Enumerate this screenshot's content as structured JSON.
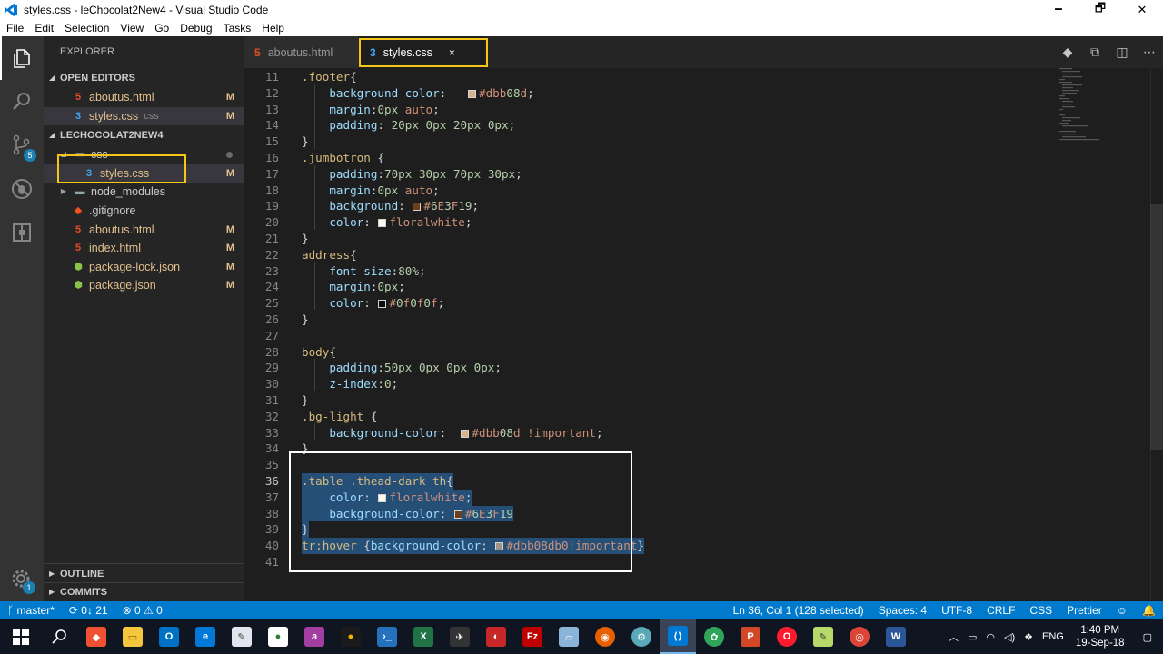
{
  "window": {
    "title": "styles.css - leChocolat2New4 - Visual Studio Code",
    "minimize": "🗕",
    "restore": "🗗",
    "close": "✕"
  },
  "menu": [
    "File",
    "Edit",
    "Selection",
    "View",
    "Go",
    "Debug",
    "Tasks",
    "Help"
  ],
  "activity_bar": {
    "items": [
      "explorer-icon",
      "search-icon",
      "source-control-icon",
      "debug-icon",
      "extensions-icon"
    ],
    "scm_badge": "5",
    "settings_badge": "1"
  },
  "sidebar": {
    "title": "EXPLORER",
    "open_editors_label": "OPEN EDITORS",
    "open_editors": [
      {
        "name": "aboutus.html",
        "type": "html",
        "status": "M"
      },
      {
        "name": "styles.css",
        "type": "css",
        "folder": "css",
        "status": "M"
      }
    ],
    "project_label": "LECHOCOLAT2NEW4",
    "tree": [
      {
        "name": "css",
        "type": "folder",
        "expanded": true
      },
      {
        "name": "styles.css",
        "type": "css",
        "status": "M"
      },
      {
        "name": "node_modules",
        "type": "folder",
        "expanded": false
      },
      {
        "name": ".gitignore",
        "type": "git"
      },
      {
        "name": "aboutus.html",
        "type": "html",
        "status": "M"
      },
      {
        "name": "index.html",
        "type": "html",
        "status": "M"
      },
      {
        "name": "package-lock.json",
        "type": "json",
        "status": "M"
      },
      {
        "name": "package.json",
        "type": "json",
        "status": "M"
      }
    ],
    "outline_label": "OUTLINE",
    "commits_label": "COMMITS"
  },
  "tabs": [
    {
      "label": "aboutus.html",
      "type": "html",
      "active": false
    },
    {
      "label": "styles.css",
      "type": "css",
      "active": true,
      "close": "×"
    }
  ],
  "editor": {
    "lines": [
      {
        "n": "11",
        "text": ".footer{"
      },
      {
        "n": "12",
        "text": "    background-color:   #dbb08d;"
      },
      {
        "n": "13",
        "text": "    margin:0px auto;"
      },
      {
        "n": "14",
        "text": "    padding: 20px 0px 20px 0px;"
      },
      {
        "n": "15",
        "text": "}"
      },
      {
        "n": "16",
        "text": ".jumbotron {"
      },
      {
        "n": "17",
        "text": "    padding:70px 30px 70px 30px;"
      },
      {
        "n": "18",
        "text": "    margin:0px auto;"
      },
      {
        "n": "19",
        "text": "    background: #6E3F19;"
      },
      {
        "n": "20",
        "text": "    color: floralwhite;"
      },
      {
        "n": "21",
        "text": "}"
      },
      {
        "n": "22",
        "text": "address{"
      },
      {
        "n": "23",
        "text": "    font-size:80%;"
      },
      {
        "n": "24",
        "text": "    margin:0px;"
      },
      {
        "n": "25",
        "text": "    color: #0f0f0f;"
      },
      {
        "n": "26",
        "text": "}"
      },
      {
        "n": "27",
        "text": ""
      },
      {
        "n": "28",
        "text": "body{"
      },
      {
        "n": "29",
        "text": "    padding:50px 0px 0px 0px;"
      },
      {
        "n": "30",
        "text": "    z-index:0;"
      },
      {
        "n": "31",
        "text": "}"
      },
      {
        "n": "32",
        "text": ".bg-light {"
      },
      {
        "n": "33",
        "text": "    background-color:  #dbb08d !important;"
      },
      {
        "n": "34",
        "text": "}"
      },
      {
        "n": "35",
        "text": ""
      },
      {
        "n": "36",
        "text": ".table .thead-dark th{"
      },
      {
        "n": "37",
        "text": "    color: floralwhite;"
      },
      {
        "n": "38",
        "text": "    background-color: #6E3F19"
      },
      {
        "n": "39",
        "text": "}"
      },
      {
        "n": "40",
        "text": "tr:hover {background-color: #dbb08db0!important}"
      },
      {
        "n": "41",
        "text": ""
      }
    ],
    "current_line": "36"
  },
  "colors": {
    "swatch_tan": "#dbb08d",
    "swatch_brown": "#6E3F19",
    "swatch_white": "#fffaf0",
    "swatch_dark": "#0f0f0f",
    "swatch_tan_alpha": "#dbb08db0",
    "highlight_yellow": "#f5c518",
    "statusbar": "#007acc"
  },
  "statusbar": {
    "branch": "master*",
    "sync": "0↓ 21",
    "problems": "⊗ 0 ⚠ 0",
    "position": "Ln 36, Col 1 (128 selected)",
    "spaces": "Spaces: 4",
    "encoding": "UTF-8",
    "eol": "CRLF",
    "language": "CSS",
    "formatter": "Prettier",
    "feedback": "☺",
    "notifications": "🔔"
  },
  "taskbar": {
    "apps": [
      "windows-start-icon",
      "search-icon",
      "git-icon",
      "file-explorer-icon",
      "outlook-icon",
      "edge-icon",
      "paint-icon",
      "image-app-icon",
      "app-icon",
      "app-icon",
      "powershell-icon",
      "excel-icon",
      "app-icon",
      "app-icon",
      "filezilla-icon",
      "app-icon",
      "firefox-icon",
      "app-icon",
      "vscode-icon",
      "app-icon",
      "powerpoint-icon",
      "opera-icon",
      "notepad-icon",
      "chrome-icon",
      "word-icon"
    ],
    "language": "ENG",
    "time": "1:40 PM",
    "date": "19-Sep-18"
  }
}
